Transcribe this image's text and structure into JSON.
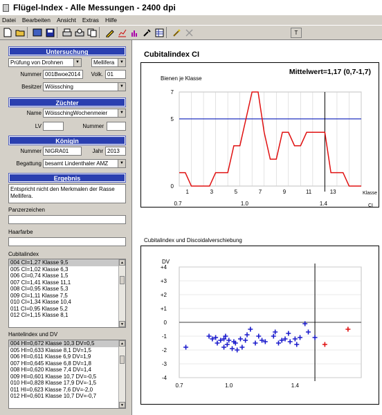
{
  "window": {
    "title": "Flügel-Index - Alle Messungen - 2400 dpi"
  },
  "menu": [
    "Datei",
    "Bearbeiten",
    "Ansicht",
    "Extras",
    "Hilfe"
  ],
  "toolbar": {
    "t_label": "T"
  },
  "untersuchung": {
    "header": "Untersuchung",
    "type": "Prüfung von Drohnen",
    "race": "Mellifera",
    "nummer_label": "Nummer",
    "nummer": "001Bwoe2014",
    "volk_label": "Volk.",
    "volk": "01",
    "besitzer_label": "Besitzer",
    "besitzer": "Wöissching"
  },
  "zuechter": {
    "header": "Züchter",
    "name_label": "Name",
    "name": "WöisschingWochenmeier",
    "lv_label": "LV",
    "lv": "",
    "nummer_label": "Nummer",
    "nummer": ""
  },
  "koenigin": {
    "header": "Königin",
    "nummer_label": "Nummer",
    "nummer": "NIGRA01",
    "jahr_label": "Jahr",
    "jahr": "2013",
    "begattung_label": "Begattung",
    "begattung": "besamt Lindenthaler AMZ"
  },
  "ergebnis": {
    "header": "Ergebnis",
    "text": "Entspricht nicht den Merkmalen der Rasse Mellifera.",
    "farbzeichen_label": "Panzerzeichen",
    "farbzeichen": "",
    "haarfarbe_label": "Haarfarbe",
    "haarfarbe": ""
  },
  "cubitalindex": {
    "label": "Cubitalindex",
    "rows": [
      "004  CI=1,27  Klasse 9,5",
      "005  CI=1,02  Klasse 6,3",
      "006  CI=0,74  Klasse 1,5",
      "007  CI=1,41  Klasse 11,1",
      "008  CI=0,95  Klasse 5,3",
      "009  CI=1,11  Klasse 7,5",
      "010  CI=1,34  Klasse 10,4",
      "011  CI=0,95  Klasse 5,2",
      "012  CI=1,15  Klasse 8,1"
    ]
  },
  "hantel": {
    "label": "Hantelindex und DV",
    "rows": [
      "004  HI=0,672  Klasse 10,3  DV=0,5",
      "005  HI=0,633  Klasse 8,1  DV=1,5",
      "006  HI=0,611  Klasse 6,9  DV=1,9",
      "007  HI=0,645  Klasse 6,8  DV=1,8",
      "008  HI=0,620  Klasse 7,4  DV=1,4",
      "009  HI=0,601  Klasse 10,7  DV=-0,5",
      "010  HI=0,828  Klasse 17,9  DV=-1,5",
      "011  HI=0,623  Klasse 7,6  DV=-2,0",
      "012  HI=0,601  Klasse 10,7  DV=-0,7"
    ]
  },
  "chart_data": [
    {
      "type": "line",
      "title": "Cubitalindex CI",
      "ylabel": "Bienen je Klasse",
      "xlabel": "Klasse",
      "x2label": "CI",
      "annotation": "Mittelwert=1,17 (0,7-1,7)",
      "x": [
        0,
        1,
        2,
        3,
        4,
        5,
        6,
        7,
        8,
        9,
        10,
        11,
        12,
        13,
        14,
        15,
        16,
        17,
        18,
        19,
        20,
        21,
        22,
        23,
        24,
        25,
        26,
        27,
        28,
        29,
        30
      ],
      "values": [
        1,
        1,
        0,
        0,
        0,
        0,
        1,
        1,
        1,
        3,
        3,
        5,
        7,
        7,
        4,
        2,
        2,
        4,
        4,
        3,
        3,
        4,
        4,
        4,
        4,
        1,
        1,
        1,
        0,
        0,
        0
      ],
      "reference_line": 5,
      "marker_x": 24,
      "xticks": [
        "1",
        "3",
        "5",
        "7",
        "9",
        "11",
        "13"
      ],
      "yticks": [
        "0",
        "5",
        "7"
      ],
      "x2ticks": [
        "0.7",
        "1.0",
        "1.4"
      ],
      "ylim": [
        0,
        7
      ]
    },
    {
      "type": "scatter",
      "title": "Cubitalindex und Discoidalverschiebung",
      "ylabel": "DV",
      "xlabel": "CI",
      "yticks": [
        "+4",
        "+3",
        "+2",
        "+1",
        "0",
        "-1",
        "-2",
        "-3",
        "-4"
      ],
      "xticks": [
        "0.7",
        "1.0",
        "1.4"
      ],
      "ylim": [
        -4,
        4
      ],
      "xlim": [
        0.7,
        1.8
      ],
      "series": [
        {
          "color": "#1a1acc",
          "points": [
            [
              0.74,
              -1.8
            ],
            [
              0.88,
              -1.0
            ],
            [
              0.9,
              -1.2
            ],
            [
              0.92,
              -1.1
            ],
            [
              0.93,
              -1.5
            ],
            [
              0.95,
              -1.3
            ],
            [
              0.97,
              -1.2
            ],
            [
              0.97,
              -1.8
            ],
            [
              0.98,
              -1.0
            ],
            [
              0.99,
              -1.6
            ],
            [
              1.0,
              -1.3
            ],
            [
              1.02,
              -1.9
            ],
            [
              1.03,
              -1.4
            ],
            [
              1.04,
              -1.5
            ],
            [
              1.05,
              -2.0
            ],
            [
              1.07,
              -1.2
            ],
            [
              1.08,
              -1.8
            ],
            [
              1.1,
              -1.3
            ],
            [
              1.11,
              -0.9
            ],
            [
              1.13,
              -0.5
            ],
            [
              1.16,
              -1.5
            ],
            [
              1.18,
              -1.0
            ],
            [
              1.2,
              -1.3
            ],
            [
              1.22,
              -1.4
            ],
            [
              1.27,
              -1.0
            ],
            [
              1.28,
              -0.7
            ],
            [
              1.3,
              -1.5
            ],
            [
              1.32,
              -1.3
            ],
            [
              1.34,
              -1.2
            ],
            [
              1.36,
              -0.8
            ],
            [
              1.37,
              -1.4
            ],
            [
              1.4,
              -1.2
            ],
            [
              1.41,
              -1.6
            ],
            [
              1.43,
              -1.1
            ],
            [
              1.46,
              -0.1
            ],
            [
              1.48,
              -0.7
            ],
            [
              1.52,
              -1.1
            ]
          ]
        },
        {
          "color": "#e01010",
          "points": [
            [
              1.58,
              -1.6
            ],
            [
              1.72,
              -0.5
            ]
          ]
        }
      ]
    }
  ]
}
